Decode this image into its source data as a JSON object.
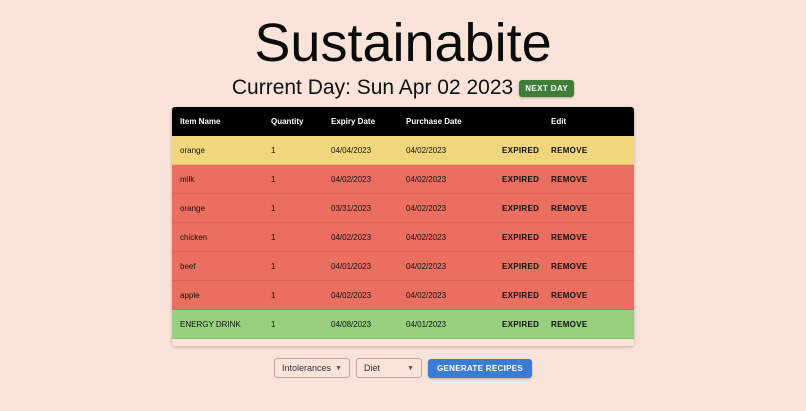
{
  "app": {
    "title": "Sustainabite",
    "current_day": "Current Day: Sun Apr 02 2023",
    "next_day_label": "NEXT DAY"
  },
  "table": {
    "headers": [
      "Item Name",
      "Quantity",
      "Expiry Date",
      "Purchase Date",
      "",
      "Edit"
    ],
    "rows": [
      {
        "item": "orange",
        "quantity": "1",
        "expiry": "04/04/2023",
        "purchase": "04/02/2023",
        "status": "EXPIRED",
        "action": "REMOVE",
        "color": "#f2d67d"
      },
      {
        "item": "milk",
        "quantity": "1",
        "expiry": "04/02/2023",
        "purchase": "04/02/2023",
        "status": "EXPIRED",
        "action": "REMOVE",
        "color": "#eb6f61"
      },
      {
        "item": "orange",
        "quantity": "1",
        "expiry": "03/31/2023",
        "purchase": "04/02/2023",
        "status": "EXPIRED",
        "action": "REMOVE",
        "color": "#eb6f61"
      },
      {
        "item": "chicken",
        "quantity": "1",
        "expiry": "04/02/2023",
        "purchase": "04/02/2023",
        "status": "EXPIRED",
        "action": "REMOVE",
        "color": "#eb6f61"
      },
      {
        "item": "beef",
        "quantity": "1",
        "expiry": "04/01/2023",
        "purchase": "04/02/2023",
        "status": "EXPIRED",
        "action": "REMOVE",
        "color": "#eb6f61"
      },
      {
        "item": "apple",
        "quantity": "1",
        "expiry": "04/02/2023",
        "purchase": "04/02/2023",
        "status": "EXPIRED",
        "action": "REMOVE",
        "color": "#eb6f61"
      },
      {
        "item": "ENERGY DRINK",
        "quantity": "1",
        "expiry": "04/08/2023",
        "purchase": "04/01/2023",
        "status": "EXPIRED",
        "action": "REMOVE",
        "color": "#97d07e"
      }
    ]
  },
  "controls": {
    "intolerances_label": "Intolerances",
    "diet_label": "Diet",
    "generate_label": "GENERATE RECIPES",
    "dropdown_icon": "caret-down-icon"
  },
  "colors": {
    "background": "#fae3d8",
    "next_day_button": "#3f7e38",
    "generate_button": "#3a7bd5",
    "header": "#000000"
  }
}
